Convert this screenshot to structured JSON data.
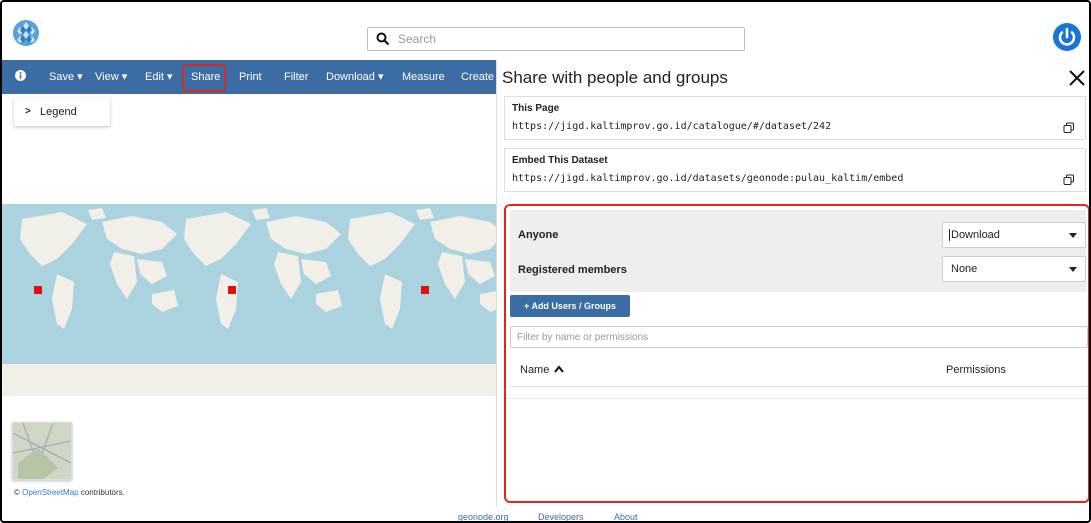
{
  "header": {
    "search_placeholder": "Search"
  },
  "toolbar": {
    "items": [
      "Save",
      "View",
      "Edit",
      "Share",
      "Print",
      "Filter",
      "Download",
      "Measure",
      "Create"
    ],
    "highlighted": "Share",
    "accent": "#3b6ca3",
    "highlight_color": "#e0261c"
  },
  "map": {
    "legend_label": "Legend",
    "attribution_prefix": "©",
    "attribution_link": "OpenStreetMap",
    "attribution_suffix": "contributors."
  },
  "footer": {
    "links": [
      "geonode.org",
      "Developers",
      "About"
    ]
  },
  "share_panel": {
    "title": "Share with people and groups",
    "this_page": {
      "heading": "This Page",
      "url": "https://jigd.kaltimprov.go.id/catalogue/#/dataset/242"
    },
    "embed": {
      "heading": "Embed This Dataset",
      "url": "https://jigd.kaltimprov.go.id/datasets/geonode:pulau_kaltim/embed"
    },
    "permissions": {
      "anyone_label": "Anyone",
      "anyone_value": "Download",
      "registered_label": "Registered members",
      "registered_value": "None",
      "add_button": "+ Add Users / Groups",
      "filter_placeholder": "Filter by name or permissions",
      "col_name": "Name",
      "col_permissions": "Permissions"
    }
  }
}
